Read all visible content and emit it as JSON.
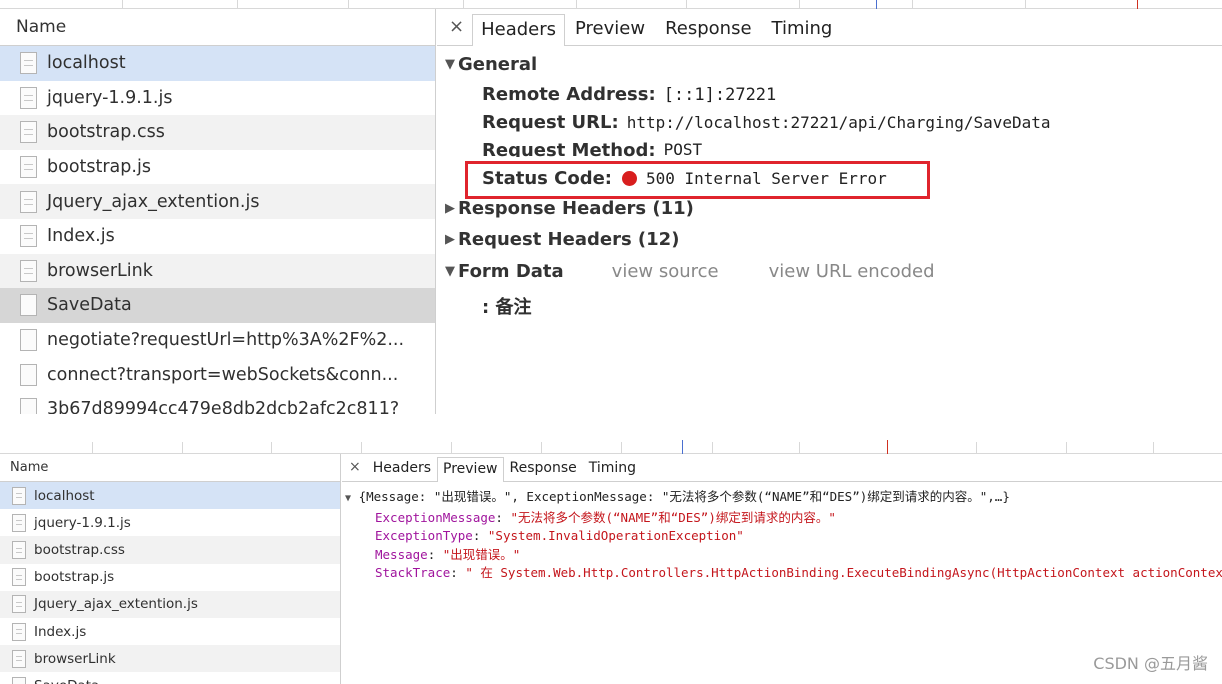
{
  "top": {
    "list_header": "Name",
    "rows": [
      {
        "label": "localhost",
        "icon": "file-icon"
      },
      {
        "label": "jquery-1.9.1.js",
        "icon": "file-icon"
      },
      {
        "label": "bootstrap.css",
        "icon": "file-icon"
      },
      {
        "label": "bootstrap.js",
        "icon": "file-icon"
      },
      {
        "label": "Jquery_ajax_extention.js",
        "icon": "file-icon"
      },
      {
        "label": "Index.js",
        "icon": "file-icon"
      },
      {
        "label": "browserLink",
        "icon": "file-icon"
      },
      {
        "label": "SaveData",
        "icon": "blank-file-icon"
      },
      {
        "label": "negotiate?requestUrl=http%3A%2F%2...",
        "icon": "blank-file-icon"
      },
      {
        "label": "connect?transport=webSockets&conn...",
        "icon": "blank-file-icon"
      },
      {
        "label": "3b67d89994cc479e8db2dcb2afc2c811?",
        "icon": "blank-file-icon"
      }
    ],
    "tabs": {
      "close": "×",
      "headers": "Headers",
      "preview": "Preview",
      "response": "Response",
      "timing": "Timing"
    },
    "general": {
      "title": "General",
      "remote_address_label": "Remote Address:",
      "remote_address_value": "[::1]:27221",
      "request_url_label": "Request URL:",
      "request_url_value": "http://localhost:27221/api/Charging/SaveData",
      "request_method_label": "Request Method:",
      "request_method_value": "POST",
      "status_code_label": "Status Code:",
      "status_code_value": "500 Internal Server Error"
    },
    "response_headers": "Response Headers (11)",
    "request_headers": "Request Headers (12)",
    "form_data": {
      "title": "Form Data",
      "view_source": "view source",
      "view_url_encoded": "view URL encoded",
      "entry": ": 备注"
    },
    "colors": {
      "status_dot": "#d81e1e",
      "highlight_box": "#e0242d"
    }
  },
  "bottom": {
    "list_header": "Name",
    "rows": [
      {
        "label": "localhost",
        "icon": "file-icon"
      },
      {
        "label": "jquery-1.9.1.js",
        "icon": "file-icon"
      },
      {
        "label": "bootstrap.css",
        "icon": "file-icon"
      },
      {
        "label": "bootstrap.js",
        "icon": "file-icon"
      },
      {
        "label": "Jquery_ajax_extention.js",
        "icon": "file-icon"
      },
      {
        "label": "Index.js",
        "icon": "file-icon"
      },
      {
        "label": "browserLink",
        "icon": "file-icon"
      },
      {
        "label": "SaveData",
        "icon": "blank-file-icon"
      }
    ],
    "tabs": {
      "close": "×",
      "headers": "Headers",
      "preview": "Preview",
      "response": "Response",
      "timing": "Timing"
    },
    "preview": {
      "summary": "{Message: \"出现错误。\", ExceptionMessage: \"无法将多个参数(“NAME”和“DES”)绑定到请求的内容。\",…}",
      "props": [
        {
          "key": "ExceptionMessage",
          "value": "\"无法将多个参数(“NAME”和“DES”)绑定到请求的内容。\""
        },
        {
          "key": "ExceptionType",
          "value": "\"System.InvalidOperationException\""
        },
        {
          "key": "Message",
          "value": "\"出现错误。\""
        },
        {
          "key": "StackTrace",
          "value": "\" 在 System.Web.Http.Controllers.HttpActionBinding.ExecuteBindingAsync(HttpActionContext actionContext, CancellationToken cancellationToken)\""
        }
      ]
    }
  },
  "watermark": "CSDN @五月酱"
}
